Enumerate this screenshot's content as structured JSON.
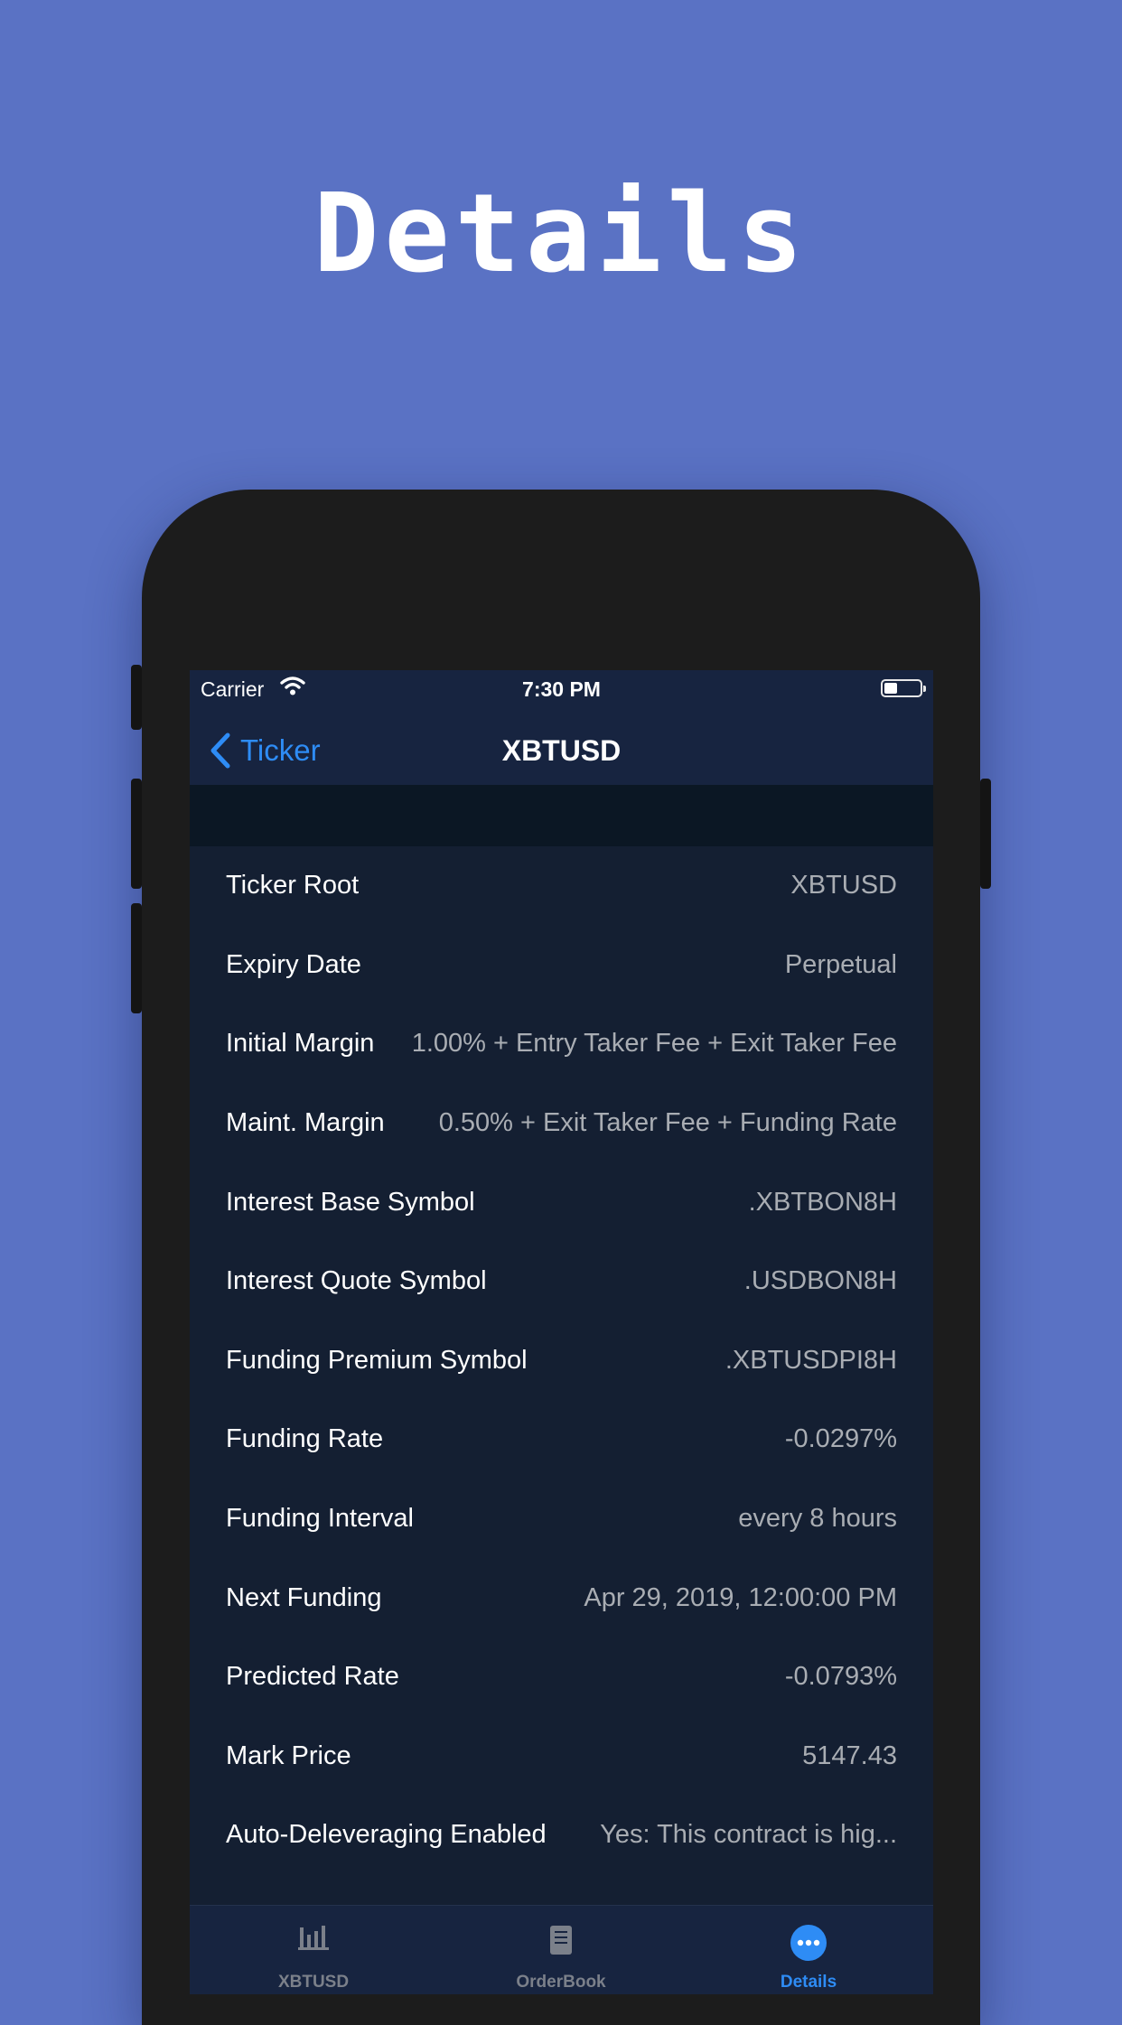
{
  "headline": "Details",
  "status_bar": {
    "carrier": "Carrier",
    "time": "7:30 PM"
  },
  "nav": {
    "back_label": "Ticker",
    "title": "XBTUSD"
  },
  "details": [
    {
      "label": "Ticker Root",
      "value": "XBTUSD"
    },
    {
      "label": "Expiry Date",
      "value": "Perpetual"
    },
    {
      "label": "Initial Margin",
      "value": "1.00% + Entry Taker Fee + Exit Taker Fee"
    },
    {
      "label": "Maint. Margin",
      "value": "0.50% + Exit Taker Fee + Funding Rate"
    },
    {
      "label": "Interest Base Symbol",
      "value": ".XBTBON8H"
    },
    {
      "label": "Interest Quote Symbol",
      "value": ".USDBON8H"
    },
    {
      "label": "Funding Premium Symbol",
      "value": ".XBTUSDPI8H"
    },
    {
      "label": "Funding Rate",
      "value": "-0.0297%"
    },
    {
      "label": "Funding Interval",
      "value": "every 8 hours"
    },
    {
      "label": "Next Funding",
      "value": "Apr 29, 2019, 12:00:00 PM"
    },
    {
      "label": "Predicted Rate",
      "value": "-0.0793%"
    },
    {
      "label": "Mark Price",
      "value": "5147.43"
    },
    {
      "label": "Auto-Deleveraging Enabled",
      "value": "Yes: This contract is hig..."
    }
  ],
  "tabs": [
    {
      "label": "XBTUSD",
      "icon": "chart-bars-icon",
      "active": false
    },
    {
      "label": "OrderBook",
      "icon": "book-icon",
      "active": false
    },
    {
      "label": "Details",
      "icon": "more-dots-icon",
      "active": true
    }
  ],
  "colors": {
    "background": "#5a72c4",
    "accent": "#2e8cf5",
    "screen": "#141f32",
    "navbar": "#172440"
  }
}
